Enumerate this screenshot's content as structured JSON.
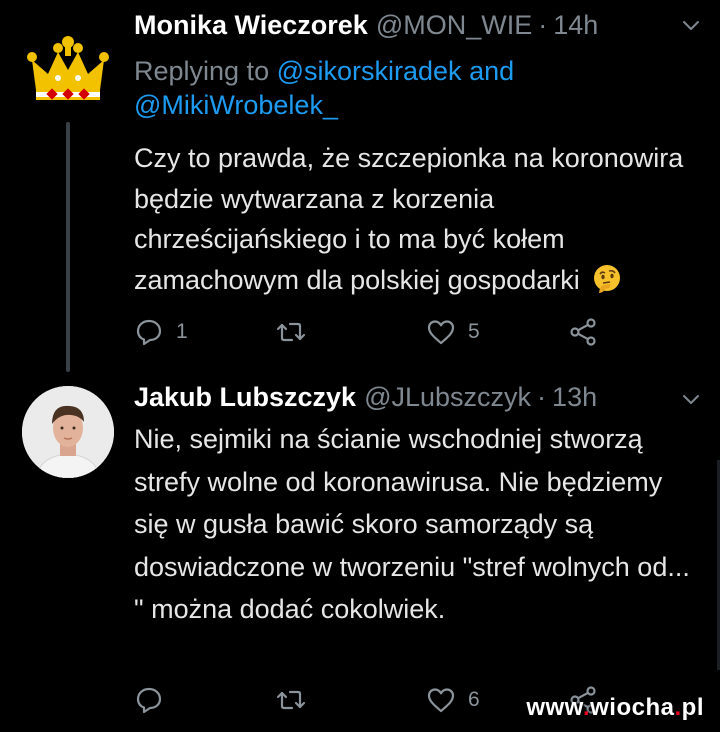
{
  "tweets": [
    {
      "author_name": "Monika Wieczorek",
      "handle": "@MON_WIE",
      "separator": "·",
      "time": "14h",
      "replying_prefix": "Replying to",
      "replying_user_1": "@sikorskiradek",
      "replying_joiner": "and",
      "replying_user_2": "@MikiWrobelek_",
      "text": "Czy to prawda, że szczepionka na koronowira będzie wytwarzana z korzenia chrześcijańskiego i to ma być kołem zamachowym dla polskiej gospodarki",
      "emoji": "thinking-face",
      "replies": "1",
      "retweets": "",
      "likes": "5"
    },
    {
      "author_name": "Jakub Lubszczyk",
      "handle": "@JLubszczyk",
      "separator": "·",
      "time": "13h",
      "text": "Nie, sejmiki na ścianie wschodniej stworzą strefy wolne od koronawirusa. Nie będziemy się w gusła bawić skoro samorządy są doswiadczone w tworzeniu \"stref wolnych od... \" można dodać cokolwiek.",
      "replies": "",
      "retweets": "",
      "likes": "6"
    }
  ],
  "watermark": {
    "prefix": "www",
    "dot1": ".",
    "brand": "wiocha",
    "dot2": ".",
    "tld": "pl"
  },
  "colors": {
    "background": "#000000",
    "link": "#1d9bf0",
    "muted": "#7f8890",
    "name": "#ffffff",
    "icon": "#8b939b",
    "watermark_accent": "#e8001c"
  },
  "icons": {
    "avatar_1": "crown-avatar",
    "avatar_2": "profile-photo-avatar",
    "reply": "reply-icon",
    "retweet": "retweet-icon",
    "like": "heart-icon",
    "share": "share-icon",
    "menu": "chevron-down-icon"
  }
}
